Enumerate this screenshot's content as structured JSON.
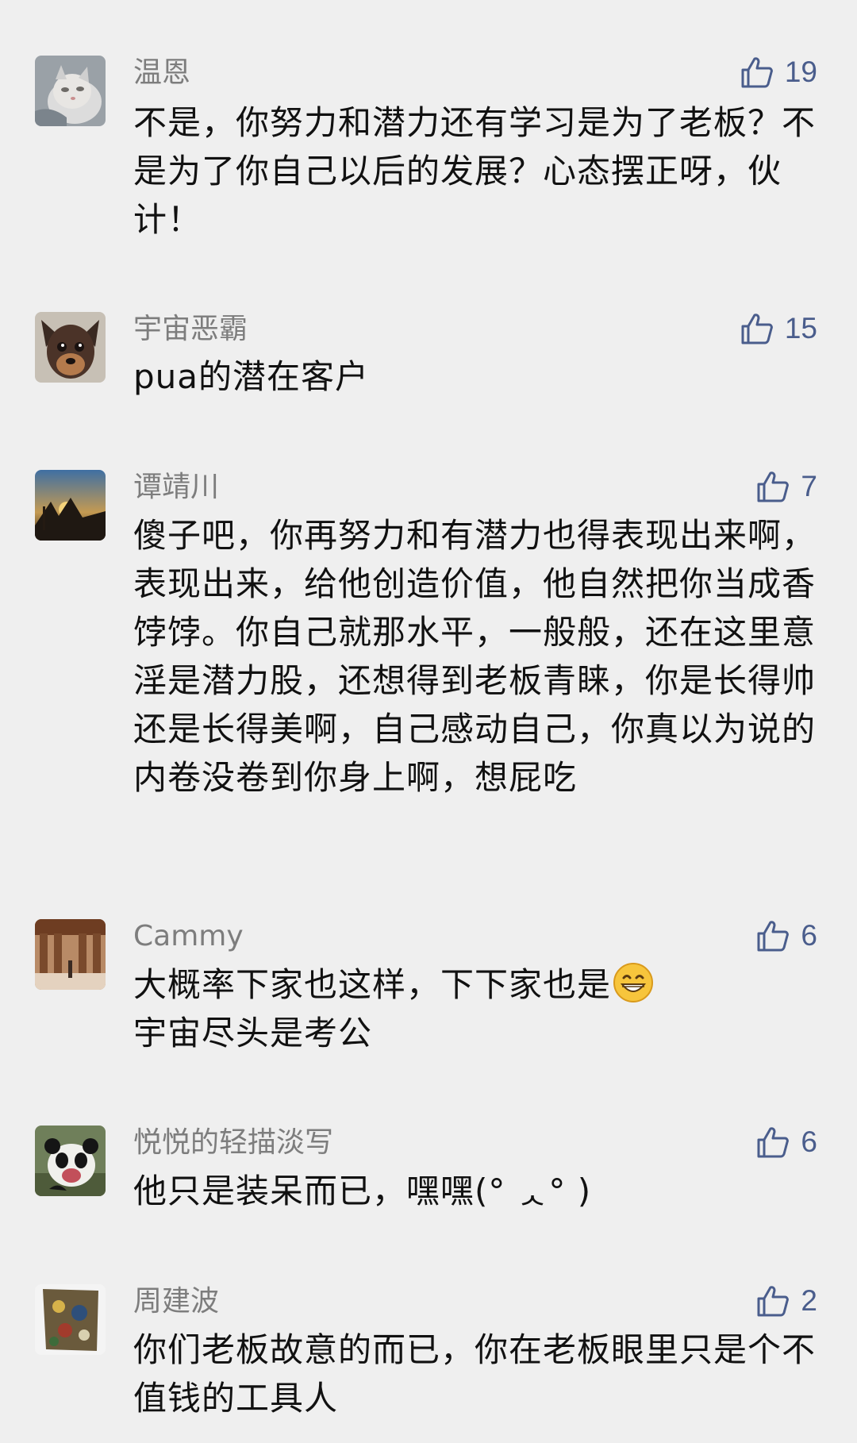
{
  "comments": [
    {
      "author": "温恩",
      "likes": "19",
      "text": "不是，你努力和潜力还有学习是为了老板？不是为了你自己以后的发展？心态摆正呀，伙计！",
      "avatar": "cat-avatar"
    },
    {
      "author": "宇宙恶霸",
      "likes": "15",
      "text": "pua的潜在客户",
      "avatar": "dog-avatar"
    },
    {
      "author": "谭靖川",
      "likes": "7",
      "text": "傻子吧，你再努力和有潜力也得表现出来啊，表现出来，给他创造价值，他自然把你当成香饽饽。你自己就那水平，一般般，还在这里意淫是潜力股，还想得到老板青睐，你是长得帅还是长得美啊，自己感动自己，你真以为说的内卷没卷到你身上啊，想屁吃",
      "avatar": "sunset-avatar"
    },
    {
      "author": "Cammy",
      "likes": "6",
      "text_before": "大概率下家也这样，下下家也是",
      "emoji": "grinning-face-emoji",
      "text_after": "宇宙尽头是考公",
      "avatar": "hall-avatar"
    },
    {
      "author": "悦悦的轻描淡写",
      "likes": "6",
      "text": "他只是装呆而已，嘿嘿(° ᆺ° )",
      "avatar": "panda-avatar"
    },
    {
      "author": "周建波",
      "likes": "2",
      "text": "你们老板故意的而已，你在老板眼里只是个不值钱的工具人",
      "avatar": "painting-avatar"
    }
  ],
  "icons": {
    "like": "thumbs-up-icon"
  },
  "colors": {
    "background": "#efefef",
    "author": "#7d7d7d",
    "like": "#4a5d8c",
    "text": "#111111"
  }
}
